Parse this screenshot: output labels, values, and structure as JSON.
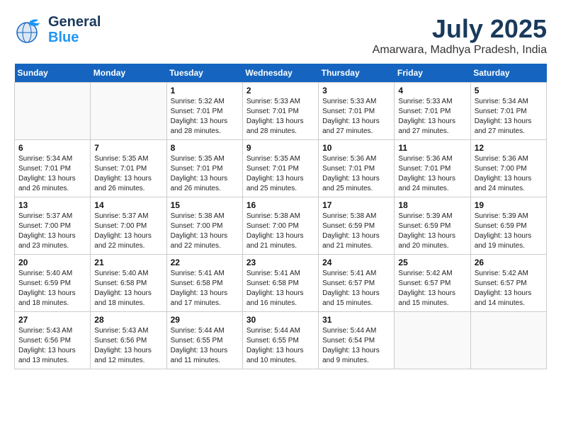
{
  "header": {
    "logo_line1": "General",
    "logo_line2": "Blue",
    "month": "July 2025",
    "location": "Amarwara, Madhya Pradesh, India"
  },
  "days_of_week": [
    "Sunday",
    "Monday",
    "Tuesday",
    "Wednesday",
    "Thursday",
    "Friday",
    "Saturday"
  ],
  "weeks": [
    [
      {
        "day": "",
        "info": ""
      },
      {
        "day": "",
        "info": ""
      },
      {
        "day": "1",
        "info": "Sunrise: 5:32 AM\nSunset: 7:01 PM\nDaylight: 13 hours and 28 minutes."
      },
      {
        "day": "2",
        "info": "Sunrise: 5:33 AM\nSunset: 7:01 PM\nDaylight: 13 hours and 28 minutes."
      },
      {
        "day": "3",
        "info": "Sunrise: 5:33 AM\nSunset: 7:01 PM\nDaylight: 13 hours and 27 minutes."
      },
      {
        "day": "4",
        "info": "Sunrise: 5:33 AM\nSunset: 7:01 PM\nDaylight: 13 hours and 27 minutes."
      },
      {
        "day": "5",
        "info": "Sunrise: 5:34 AM\nSunset: 7:01 PM\nDaylight: 13 hours and 27 minutes."
      }
    ],
    [
      {
        "day": "6",
        "info": "Sunrise: 5:34 AM\nSunset: 7:01 PM\nDaylight: 13 hours and 26 minutes."
      },
      {
        "day": "7",
        "info": "Sunrise: 5:35 AM\nSunset: 7:01 PM\nDaylight: 13 hours and 26 minutes."
      },
      {
        "day": "8",
        "info": "Sunrise: 5:35 AM\nSunset: 7:01 PM\nDaylight: 13 hours and 26 minutes."
      },
      {
        "day": "9",
        "info": "Sunrise: 5:35 AM\nSunset: 7:01 PM\nDaylight: 13 hours and 25 minutes."
      },
      {
        "day": "10",
        "info": "Sunrise: 5:36 AM\nSunset: 7:01 PM\nDaylight: 13 hours and 25 minutes."
      },
      {
        "day": "11",
        "info": "Sunrise: 5:36 AM\nSunset: 7:01 PM\nDaylight: 13 hours and 24 minutes."
      },
      {
        "day": "12",
        "info": "Sunrise: 5:36 AM\nSunset: 7:00 PM\nDaylight: 13 hours and 24 minutes."
      }
    ],
    [
      {
        "day": "13",
        "info": "Sunrise: 5:37 AM\nSunset: 7:00 PM\nDaylight: 13 hours and 23 minutes."
      },
      {
        "day": "14",
        "info": "Sunrise: 5:37 AM\nSunset: 7:00 PM\nDaylight: 13 hours and 22 minutes."
      },
      {
        "day": "15",
        "info": "Sunrise: 5:38 AM\nSunset: 7:00 PM\nDaylight: 13 hours and 22 minutes."
      },
      {
        "day": "16",
        "info": "Sunrise: 5:38 AM\nSunset: 7:00 PM\nDaylight: 13 hours and 21 minutes."
      },
      {
        "day": "17",
        "info": "Sunrise: 5:38 AM\nSunset: 6:59 PM\nDaylight: 13 hours and 21 minutes."
      },
      {
        "day": "18",
        "info": "Sunrise: 5:39 AM\nSunset: 6:59 PM\nDaylight: 13 hours and 20 minutes."
      },
      {
        "day": "19",
        "info": "Sunrise: 5:39 AM\nSunset: 6:59 PM\nDaylight: 13 hours and 19 minutes."
      }
    ],
    [
      {
        "day": "20",
        "info": "Sunrise: 5:40 AM\nSunset: 6:59 PM\nDaylight: 13 hours and 18 minutes."
      },
      {
        "day": "21",
        "info": "Sunrise: 5:40 AM\nSunset: 6:58 PM\nDaylight: 13 hours and 18 minutes."
      },
      {
        "day": "22",
        "info": "Sunrise: 5:41 AM\nSunset: 6:58 PM\nDaylight: 13 hours and 17 minutes."
      },
      {
        "day": "23",
        "info": "Sunrise: 5:41 AM\nSunset: 6:58 PM\nDaylight: 13 hours and 16 minutes."
      },
      {
        "day": "24",
        "info": "Sunrise: 5:41 AM\nSunset: 6:57 PM\nDaylight: 13 hours and 15 minutes."
      },
      {
        "day": "25",
        "info": "Sunrise: 5:42 AM\nSunset: 6:57 PM\nDaylight: 13 hours and 15 minutes."
      },
      {
        "day": "26",
        "info": "Sunrise: 5:42 AM\nSunset: 6:57 PM\nDaylight: 13 hours and 14 minutes."
      }
    ],
    [
      {
        "day": "27",
        "info": "Sunrise: 5:43 AM\nSunset: 6:56 PM\nDaylight: 13 hours and 13 minutes."
      },
      {
        "day": "28",
        "info": "Sunrise: 5:43 AM\nSunset: 6:56 PM\nDaylight: 13 hours and 12 minutes."
      },
      {
        "day": "29",
        "info": "Sunrise: 5:44 AM\nSunset: 6:55 PM\nDaylight: 13 hours and 11 minutes."
      },
      {
        "day": "30",
        "info": "Sunrise: 5:44 AM\nSunset: 6:55 PM\nDaylight: 13 hours and 10 minutes."
      },
      {
        "day": "31",
        "info": "Sunrise: 5:44 AM\nSunset: 6:54 PM\nDaylight: 13 hours and 9 minutes."
      },
      {
        "day": "",
        "info": ""
      },
      {
        "day": "",
        "info": ""
      }
    ]
  ]
}
